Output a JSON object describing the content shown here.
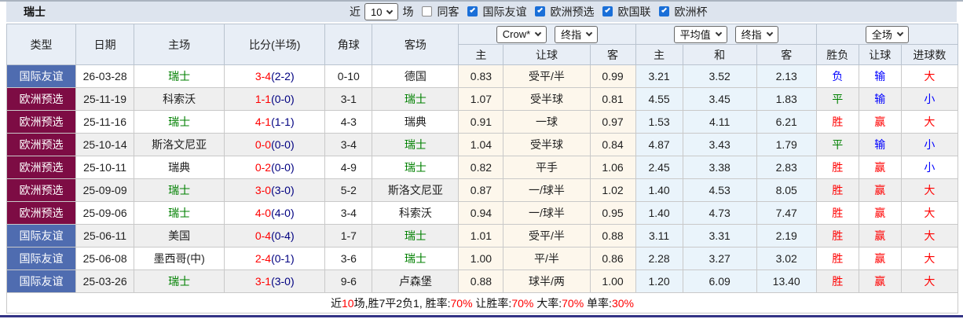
{
  "topbar": {
    "title": "瑞士",
    "near_label": "近",
    "recent_count": "10",
    "games_label": "场",
    "same_away": {
      "label": "同客",
      "checked": false
    },
    "league_filters": [
      {
        "label": "国际友谊",
        "checked": true
      },
      {
        "label": "欧洲预选",
        "checked": true
      },
      {
        "label": "欧国联",
        "checked": true
      },
      {
        "label": "欧洲杯",
        "checked": true
      }
    ]
  },
  "table": {
    "columns": {
      "type": "类型",
      "date": "日期",
      "home": "主场",
      "score": "比分(半场)",
      "corner": "角球",
      "away": "客场",
      "ah_home": "主",
      "ah_line": "让球",
      "ah_away": "客",
      "eu_home": "主",
      "eu_draw": "和",
      "eu_away": "客",
      "outcome": "胜负",
      "ah_outcome": "让球",
      "goals": "进球数"
    },
    "dropdowns": {
      "bookmaker": "Crow*",
      "handicap_final": "终指",
      "europe_avg": "平均值",
      "europe_final": "终指",
      "scope": "全场"
    },
    "rows": [
      {
        "league": "国际友谊",
        "league_style": "blue",
        "date": "26-03-28",
        "home": "瑞士",
        "home_focus": true,
        "score": "3-4",
        "half": "(2-2)",
        "corner": "0-10",
        "away": "德国",
        "away_focus": false,
        "ah": [
          "0.83",
          "受平/半",
          "0.99"
        ],
        "eu": [
          "3.21",
          "3.52",
          "2.13"
        ],
        "outcome": {
          "text": "负",
          "color": "blue"
        },
        "handicap_outcome": {
          "text": "输",
          "color": "blue"
        },
        "goals_outcome": {
          "text": "大",
          "color": "red"
        }
      },
      {
        "league": "欧洲预选",
        "league_style": "maroon",
        "date": "25-11-19",
        "home": "科索沃",
        "home_focus": false,
        "score": "1-1",
        "half": "(0-0)",
        "corner": "3-1",
        "away": "瑞士",
        "away_focus": true,
        "ah": [
          "1.07",
          "受半球",
          "0.81"
        ],
        "eu": [
          "4.55",
          "3.45",
          "1.83"
        ],
        "outcome": {
          "text": "平",
          "color": "green"
        },
        "handicap_outcome": {
          "text": "输",
          "color": "blue"
        },
        "goals_outcome": {
          "text": "小",
          "color": "blue"
        }
      },
      {
        "league": "欧洲预选",
        "league_style": "maroon",
        "date": "25-11-16",
        "home": "瑞士",
        "home_focus": true,
        "score": "4-1",
        "half": "(1-1)",
        "corner": "4-3",
        "away": "瑞典",
        "away_focus": false,
        "ah": [
          "0.91",
          "一球",
          "0.97"
        ],
        "eu": [
          "1.53",
          "4.11",
          "6.21"
        ],
        "outcome": {
          "text": "胜",
          "color": "red"
        },
        "handicap_outcome": {
          "text": "赢",
          "color": "red"
        },
        "goals_outcome": {
          "text": "大",
          "color": "red"
        }
      },
      {
        "league": "欧洲预选",
        "league_style": "maroon",
        "date": "25-10-14",
        "home": "斯洛文尼亚",
        "home_focus": false,
        "score": "0-0",
        "half": "(0-0)",
        "corner": "3-4",
        "away": "瑞士",
        "away_focus": true,
        "ah": [
          "1.04",
          "受半球",
          "0.84"
        ],
        "eu": [
          "4.87",
          "3.43",
          "1.79"
        ],
        "outcome": {
          "text": "平",
          "color": "green"
        },
        "handicap_outcome": {
          "text": "输",
          "color": "blue"
        },
        "goals_outcome": {
          "text": "小",
          "color": "blue"
        }
      },
      {
        "league": "欧洲预选",
        "league_style": "maroon",
        "date": "25-10-11",
        "home": "瑞典",
        "home_focus": false,
        "score": "0-2",
        "half": "(0-0)",
        "corner": "4-9",
        "away": "瑞士",
        "away_focus": true,
        "ah": [
          "0.82",
          "平手",
          "1.06"
        ],
        "eu": [
          "2.45",
          "3.38",
          "2.83"
        ],
        "outcome": {
          "text": "胜",
          "color": "red"
        },
        "handicap_outcome": {
          "text": "赢",
          "color": "red"
        },
        "goals_outcome": {
          "text": "小",
          "color": "blue"
        }
      },
      {
        "league": "欧洲预选",
        "league_style": "maroon",
        "date": "25-09-09",
        "home": "瑞士",
        "home_focus": true,
        "score": "3-0",
        "half": "(3-0)",
        "corner": "5-2",
        "away": "斯洛文尼亚",
        "away_focus": false,
        "ah": [
          "0.87",
          "一/球半",
          "1.02"
        ],
        "eu": [
          "1.40",
          "4.53",
          "8.05"
        ],
        "outcome": {
          "text": "胜",
          "color": "red"
        },
        "handicap_outcome": {
          "text": "赢",
          "color": "red"
        },
        "goals_outcome": {
          "text": "大",
          "color": "red"
        }
      },
      {
        "league": "欧洲预选",
        "league_style": "maroon",
        "date": "25-09-06",
        "home": "瑞士",
        "home_focus": true,
        "score": "4-0",
        "half": "(4-0)",
        "corner": "3-4",
        "away": "科索沃",
        "away_focus": false,
        "ah": [
          "0.94",
          "一/球半",
          "0.95"
        ],
        "eu": [
          "1.40",
          "4.73",
          "7.47"
        ],
        "outcome": {
          "text": "胜",
          "color": "red"
        },
        "handicap_outcome": {
          "text": "赢",
          "color": "red"
        },
        "goals_outcome": {
          "text": "大",
          "color": "red"
        }
      },
      {
        "league": "国际友谊",
        "league_style": "blue",
        "date": "25-06-11",
        "home": "美国",
        "home_focus": false,
        "score": "0-4",
        "half": "(0-4)",
        "corner": "1-7",
        "away": "瑞士",
        "away_focus": true,
        "ah": [
          "1.01",
          "受平/半",
          "0.88"
        ],
        "eu": [
          "3.11",
          "3.31",
          "2.19"
        ],
        "outcome": {
          "text": "胜",
          "color": "red"
        },
        "handicap_outcome": {
          "text": "赢",
          "color": "red"
        },
        "goals_outcome": {
          "text": "大",
          "color": "red"
        }
      },
      {
        "league": "国际友谊",
        "league_style": "blue",
        "date": "25-06-08",
        "home": "墨西哥(中)",
        "home_focus": false,
        "score": "2-4",
        "half": "(0-1)",
        "corner": "3-6",
        "away": "瑞士",
        "away_focus": true,
        "ah": [
          "1.00",
          "平/半",
          "0.86"
        ],
        "eu": [
          "2.28",
          "3.27",
          "3.02"
        ],
        "outcome": {
          "text": "胜",
          "color": "red"
        },
        "handicap_outcome": {
          "text": "赢",
          "color": "red"
        },
        "goals_outcome": {
          "text": "大",
          "color": "red"
        }
      },
      {
        "league": "国际友谊",
        "league_style": "blue",
        "date": "25-03-26",
        "home": "瑞士",
        "home_focus": true,
        "score": "3-1",
        "half": "(3-0)",
        "corner": "9-6",
        "away": "卢森堡",
        "away_focus": false,
        "ah": [
          "0.88",
          "球半/两",
          "1.00"
        ],
        "eu": [
          "1.20",
          "6.09",
          "13.40"
        ],
        "outcome": {
          "text": "胜",
          "color": "red"
        },
        "handicap_outcome": {
          "text": "赢",
          "color": "red"
        },
        "goals_outcome": {
          "text": "大",
          "color": "red"
        }
      }
    ],
    "summary_segments": [
      {
        "text": "近"
      },
      {
        "text": "10",
        "red": true
      },
      {
        "text": "场,胜7平2负1, 胜率:"
      },
      {
        "text": "70%",
        "red": true
      },
      {
        "text": " 让胜率:"
      },
      {
        "text": "70%",
        "red": true
      },
      {
        "text": " 大率:"
      },
      {
        "text": "70%",
        "red": true
      },
      {
        "text": " 单率:"
      },
      {
        "text": "30%",
        "red": true
      }
    ]
  },
  "colors": {
    "league_friendly_bg": "#4f6cb0",
    "league_qualifier_bg": "#7d0c44",
    "focus_team": "#008000",
    "score": "#ff0000",
    "half_score": "#000080",
    "win": "#ff0000",
    "draw": "#008000",
    "loss": "#0000ff",
    "handicap_col_bg": "#fdf7ec",
    "europe_col_bg": "#eaf4fb",
    "checkbox_checked": "#1a6fd8",
    "bottom_line": "#333385"
  }
}
